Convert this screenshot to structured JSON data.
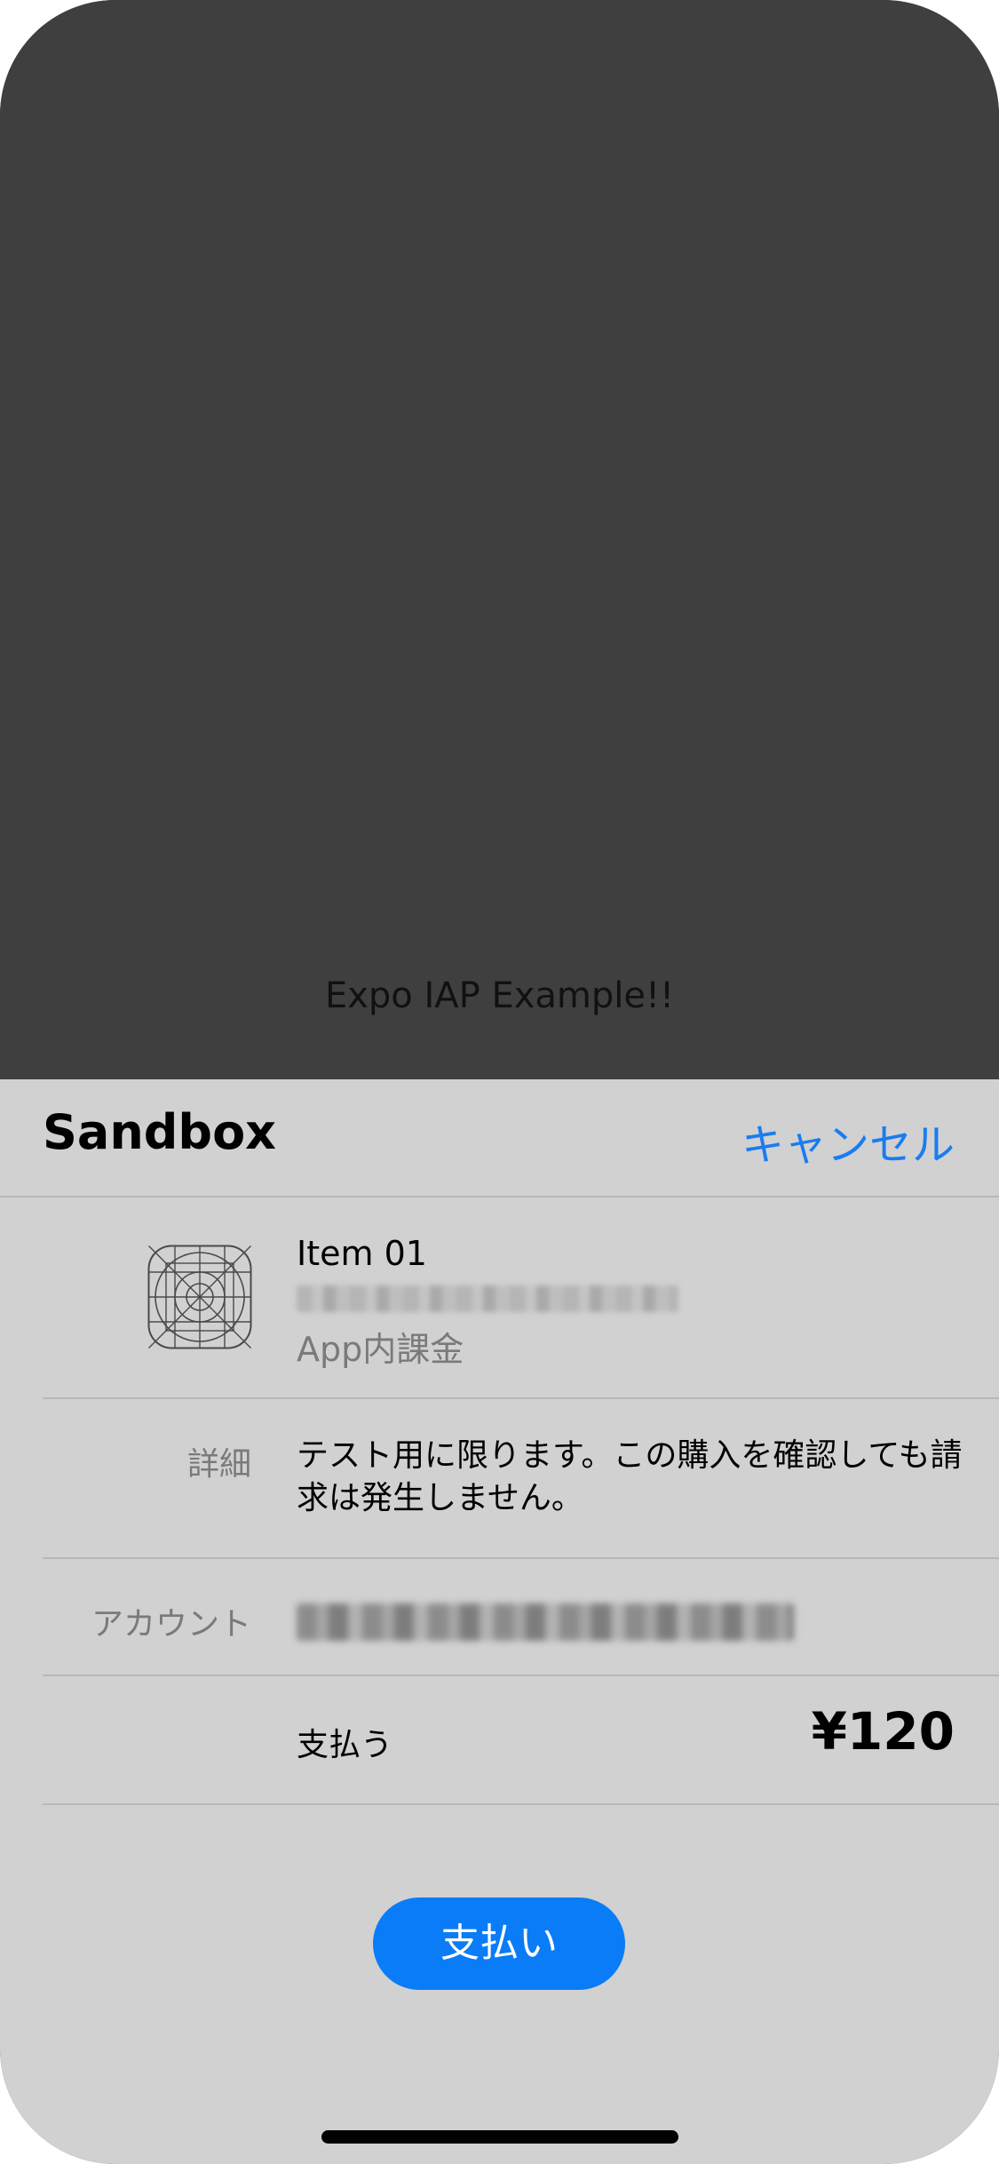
{
  "app": {
    "title": "Expo IAP Example!!"
  },
  "sheet": {
    "title": "Sandbox",
    "cancel_label": "キャンセル",
    "item": {
      "name": "Item 01",
      "type": "App内課金",
      "icon": "app-icon-placeholder"
    },
    "detail": {
      "label": "詳細",
      "text": "テスト用に限ります。この購入を確認しても請求は発生しません。"
    },
    "account": {
      "label": "アカウント"
    },
    "payment": {
      "label": "支払う",
      "price": "¥120"
    },
    "pay_button_label": "支払い"
  },
  "colors": {
    "accent": "#0a7cf7",
    "link": "#1a7cf0",
    "sheet_background": "#d1d1d1",
    "app_background": "#3f3f3f"
  }
}
